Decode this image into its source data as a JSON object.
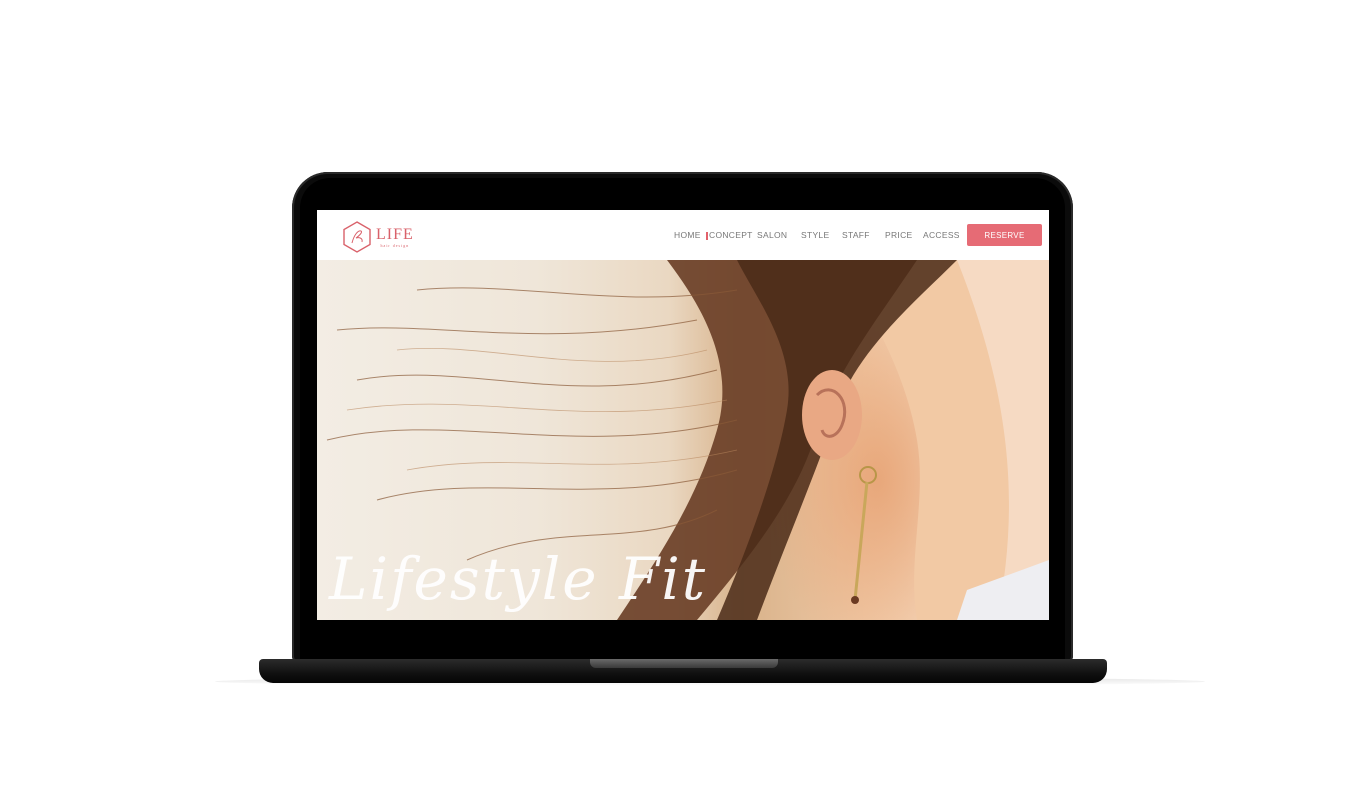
{
  "brand": {
    "name": "LIFE",
    "tagline": "hair design",
    "accent_color": "#e66b75",
    "logo_icon": "hexagon-monogram-icon"
  },
  "nav": {
    "items": [
      {
        "label": "HOME",
        "active": false
      },
      {
        "label": "CONCEPT",
        "active": true
      },
      {
        "label": "SALON",
        "active": false
      },
      {
        "label": "STYLE",
        "active": false
      },
      {
        "label": "STAFF",
        "active": false
      },
      {
        "label": "PRICE",
        "active": false
      },
      {
        "label": "ACCESS",
        "active": false
      }
    ],
    "reserve_label": "RESERVE"
  },
  "hero": {
    "script_text": "Lifestyle Fit"
  }
}
